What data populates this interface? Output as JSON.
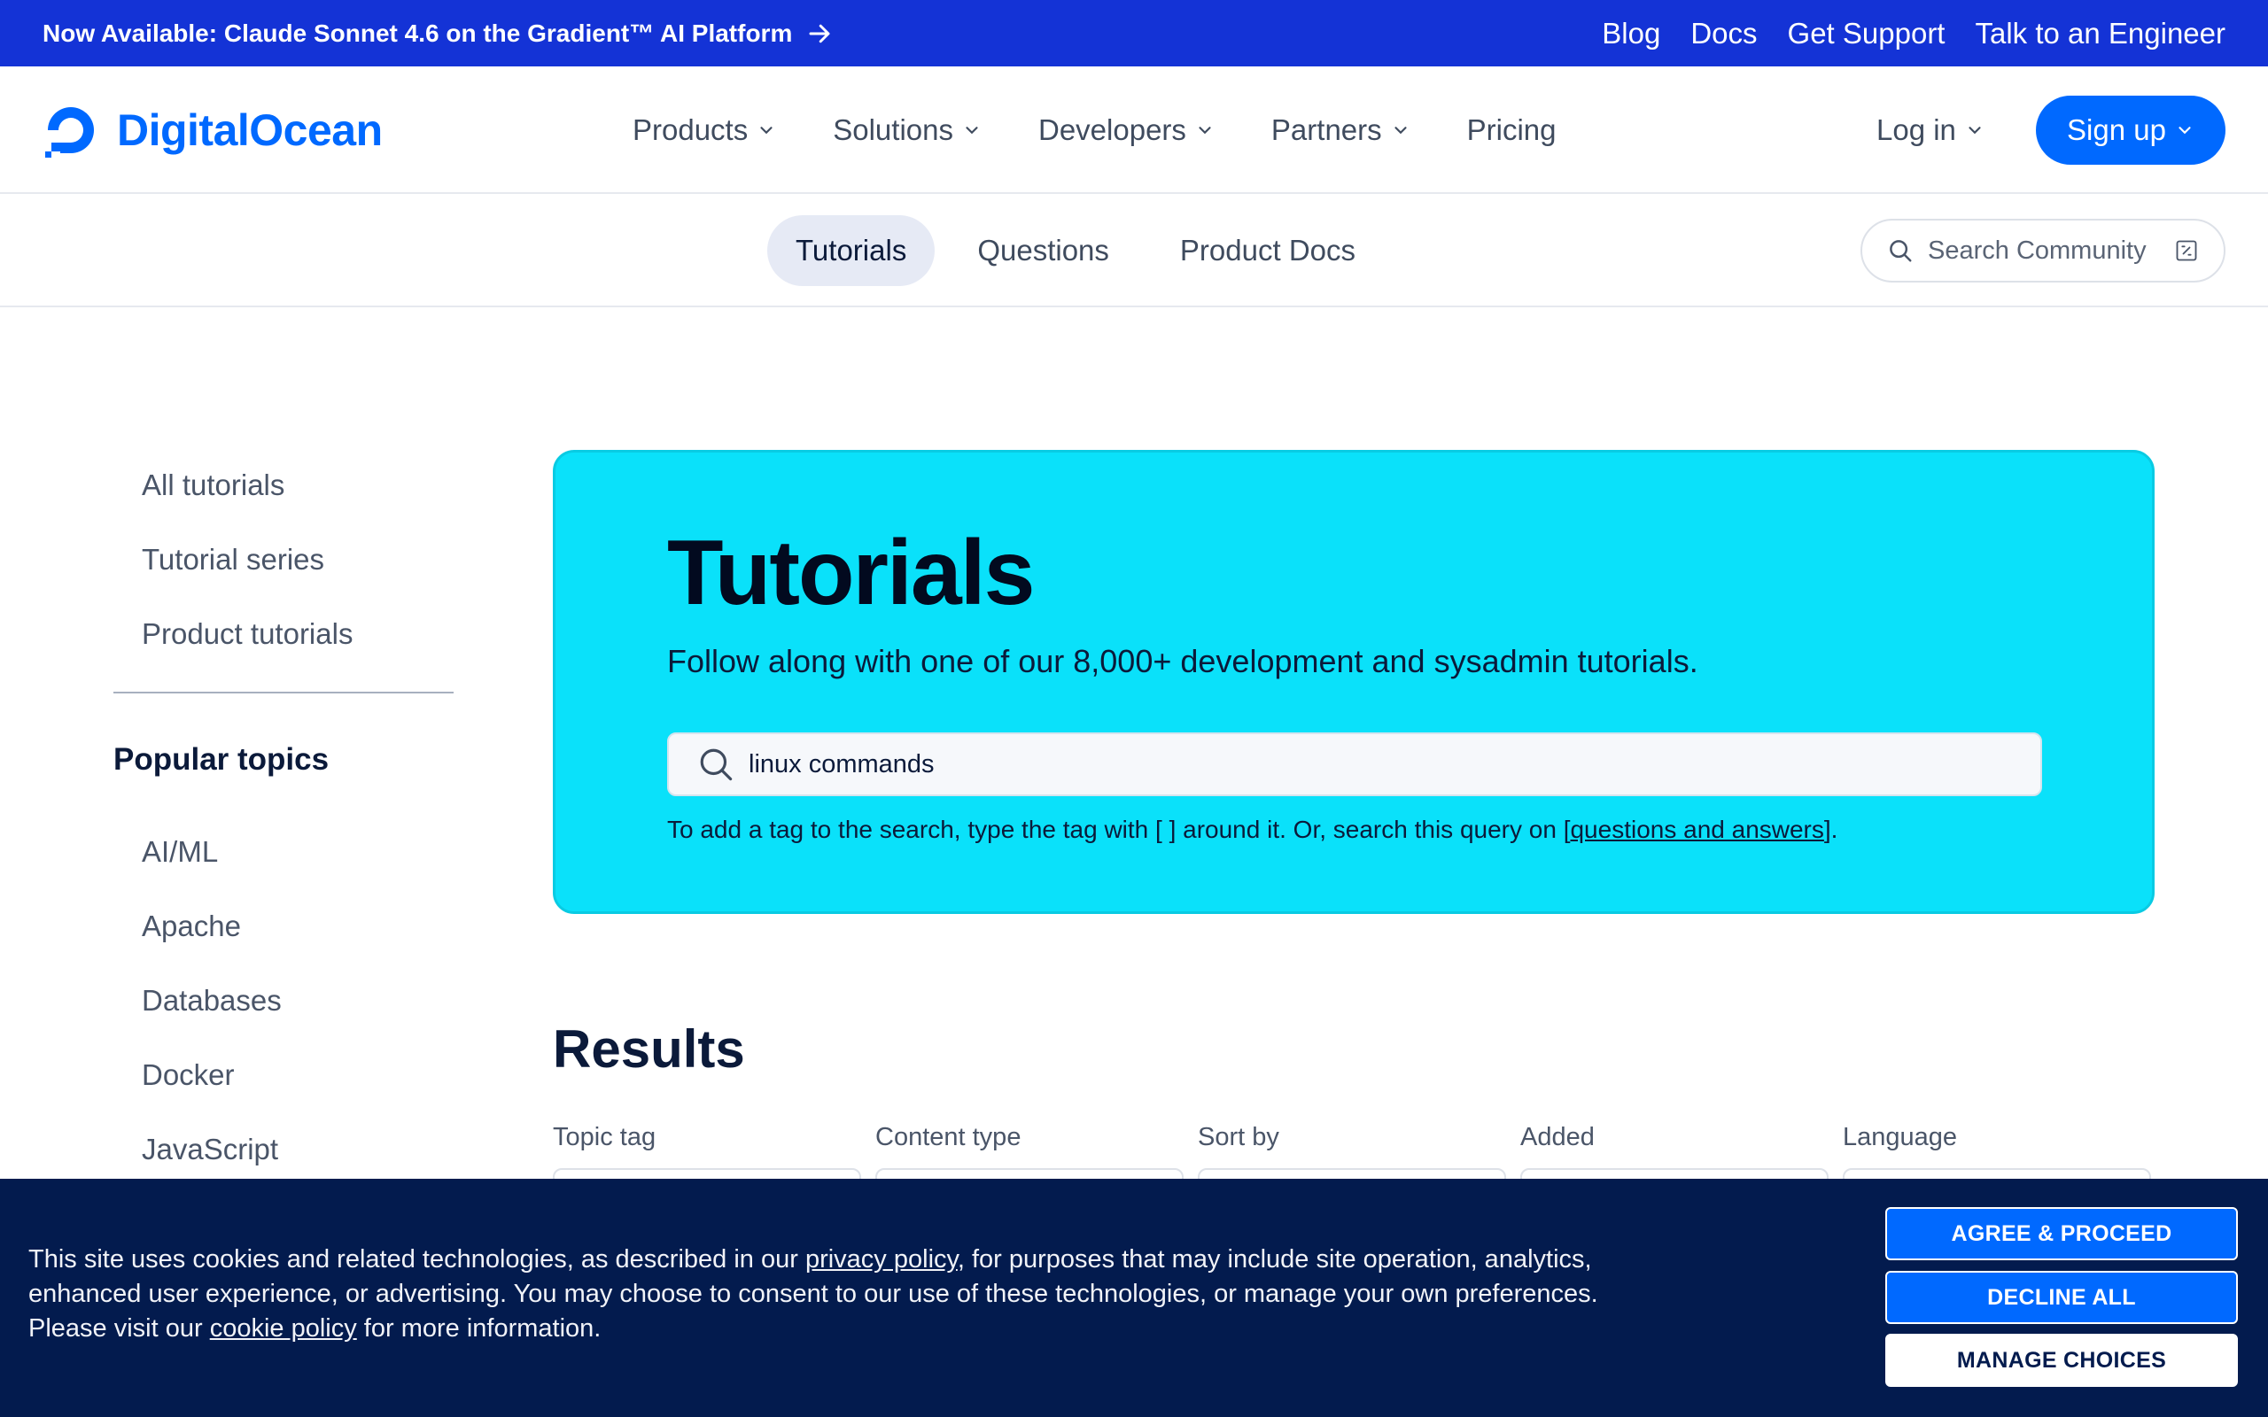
{
  "announcement": {
    "text": "Now Available: Claude Sonnet 4.6 on the Gradient™ AI Platform",
    "links": [
      "Blog",
      "Docs",
      "Get Support",
      "Talk to an Engineer"
    ]
  },
  "brand": {
    "name": "DigitalOcean",
    "color": "#0069ff"
  },
  "nav": {
    "items": [
      "Products",
      "Solutions",
      "Developers",
      "Partners",
      "Pricing"
    ],
    "login": "Log in",
    "signup": "Sign up"
  },
  "subnav": {
    "tabs": [
      "Tutorials",
      "Questions",
      "Product Docs"
    ],
    "active": "Tutorials",
    "search_label": "Search Community"
  },
  "sidebar": {
    "items": [
      "All tutorials",
      "Tutorial series",
      "Product tutorials"
    ],
    "topics_heading": "Popular topics",
    "topics": [
      "AI/ML",
      "Apache",
      "Databases",
      "Docker",
      "JavaScript"
    ]
  },
  "hero": {
    "title": "Tutorials",
    "subtitle": "Follow along with one of our 8,000+ development and sysadmin tutorials.",
    "search_value": "linux commands",
    "hint_before": "To add a tag to the search, type the tag with [ ] around it. Or, search this query on [",
    "hint_link": "questions and answers",
    "hint_after": "].",
    "background": "#0ae1fa"
  },
  "results": {
    "title": "Results",
    "filters": [
      "Topic tag",
      "Content type",
      "Sort by",
      "Added",
      "Language"
    ]
  },
  "cookie": {
    "text_1": "This site uses cookies and related technologies, as described in our ",
    "privacy_link": "privacy policy",
    "text_2": ", for purposes that may include site operation, analytics, enhanced user experience, or advertising. You may choose to consent to our use of these technologies, or manage your own preferences. Please visit our ",
    "cookie_link": "cookie policy",
    "text_3": " for more information.",
    "agree": "AGREE & PROCEED",
    "decline": "DECLINE ALL",
    "manage": "MANAGE CHOICES"
  }
}
